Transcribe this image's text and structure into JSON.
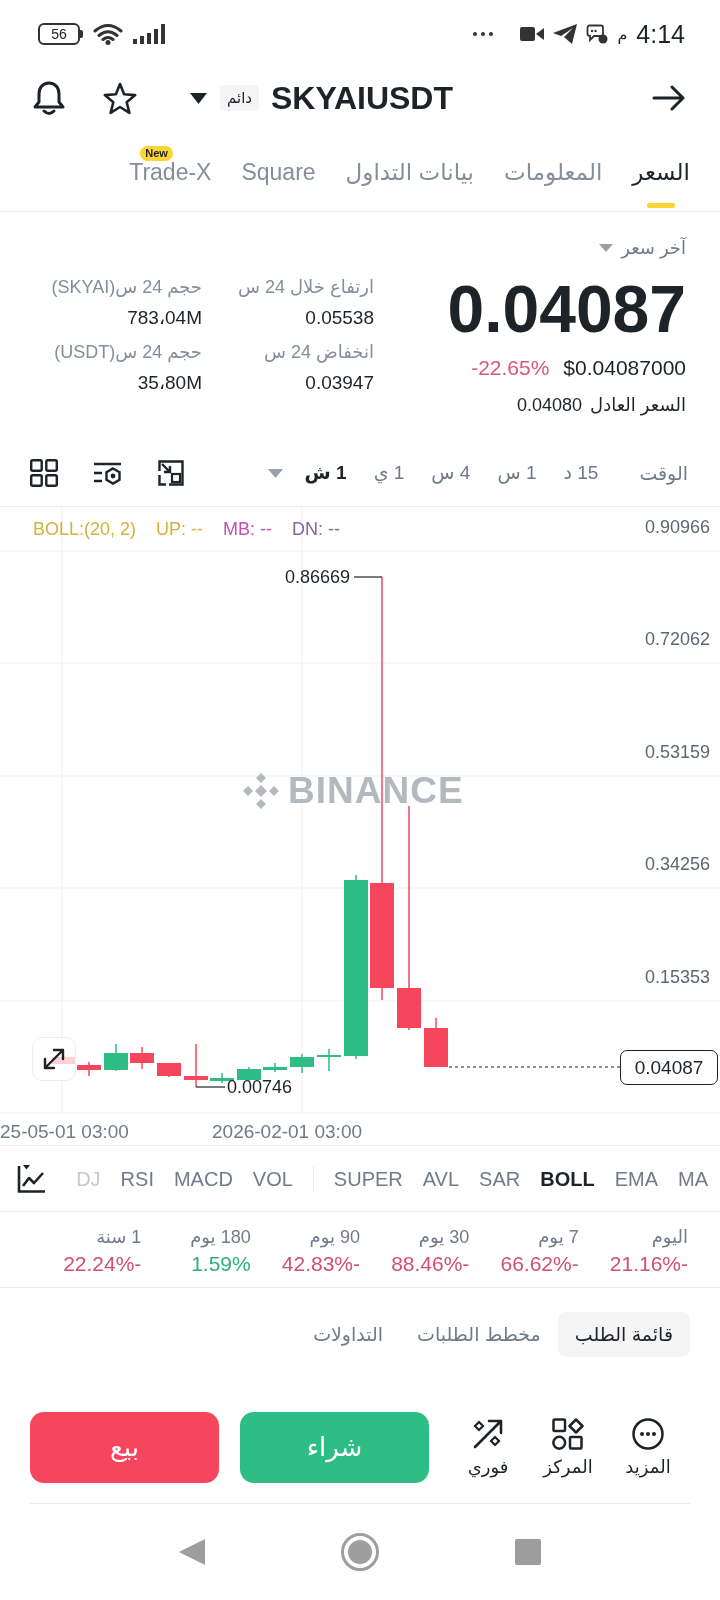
{
  "status_bar": {
    "battery": "56",
    "period": "م",
    "time": "4:14"
  },
  "header": {
    "badge": "دائم",
    "title": "SKYAIUSDT"
  },
  "tabs": [
    {
      "label": "السعر",
      "selected": true
    },
    {
      "label": "المعلومات",
      "selected": false
    },
    {
      "label": "بيانات التداول",
      "selected": false
    },
    {
      "label": "Square",
      "selected": false
    },
    {
      "label": "Trade-X",
      "selected": false,
      "badge": "New"
    }
  ],
  "price": {
    "label": "آخر سعر",
    "last": "0.04087",
    "usd": "$0.04087000",
    "change": "-22.65%",
    "fair_label": "السعر العادل",
    "fair_value": "0.04080"
  },
  "stats": [
    {
      "label": "ارتفاع خلال 24 س",
      "value": "0.05538"
    },
    {
      "label": "حجم 24 س(SKYAI)",
      "value": "783،04M"
    },
    {
      "label": "انخفاض 24 س",
      "value": "0.03947"
    },
    {
      "label": "حجم 24 س(USDT)",
      "value": "35،80M"
    }
  ],
  "chart_toolbar": {
    "label": "الوقت",
    "intervals": [
      {
        "label": "15 د",
        "selected": false
      },
      {
        "label": "1 س",
        "selected": false
      },
      {
        "label": "4 س",
        "selected": false
      },
      {
        "label": "1 ي",
        "selected": false
      },
      {
        "label": "1 ش",
        "selected": true
      }
    ]
  },
  "chart": {
    "legend": [
      {
        "text": "DN: --",
        "color": "#7b66a6"
      },
      {
        "text": "MB: --",
        "color": "#c24fb2"
      },
      {
        "text": "UP: --",
        "color": "#d4b23c"
      },
      {
        "text": "BOLL:(20, 2)",
        "color": "#d4b23c"
      }
    ],
    "watermark": "BINANCE",
    "price_labels": [
      "0.90966",
      "0.72062",
      "0.53159",
      "0.34256",
      "0.15353"
    ],
    "high_label": "0.86669",
    "low_label": "0.00746",
    "last_price": "0.04087",
    "time_labels": [
      "2026-02-01 03:00",
      "25-05-01 03:00"
    ]
  },
  "indicators": {
    "main": [
      {
        "label": "MA",
        "selected": false
      },
      {
        "label": "EMA",
        "selected": false
      },
      {
        "label": "BOLL",
        "selected": true
      },
      {
        "label": "SAR",
        "selected": false
      },
      {
        "label": "AVL",
        "selected": false
      },
      {
        "label": "SUPER",
        "selected": false
      }
    ],
    "sub": [
      {
        "label": "VOL",
        "selected": false
      },
      {
        "label": "MACD",
        "selected": false
      },
      {
        "label": "RSI",
        "selected": false
      },
      {
        "label": "DJ",
        "selected": false
      }
    ]
  },
  "performance": [
    {
      "period": "اليوم",
      "change": "21.16%-",
      "color": "#d24f6e"
    },
    {
      "period": "7 يوم",
      "change": "66.62%-",
      "color": "#d24f6e"
    },
    {
      "period": "30 يوم",
      "change": "88.46%-",
      "color": "#d24f6e"
    },
    {
      "period": "90 يوم",
      "change": "42.83%-",
      "color": "#d24f6e"
    },
    {
      "period": "180 يوم",
      "change": "1.59%",
      "color": "#2eae84"
    },
    {
      "period": "1 سنة",
      "change": "22.24%-",
      "color": "#d24f6e"
    }
  ],
  "order_tabs": [
    {
      "label": "قائمة الطلب",
      "selected": true
    },
    {
      "label": "مخطط الطلبات",
      "selected": false
    },
    {
      "label": "التداولات",
      "selected": false
    }
  ],
  "actions": [
    {
      "label": "المزيد",
      "kind": "more"
    },
    {
      "label": "المركز",
      "kind": "center"
    },
    {
      "label": "فوري",
      "kind": "instant"
    }
  ],
  "trade_buttons": [
    {
      "label": "شراء",
      "kind": "buy"
    },
    {
      "label": "بيع",
      "kind": "sell"
    }
  ]
}
